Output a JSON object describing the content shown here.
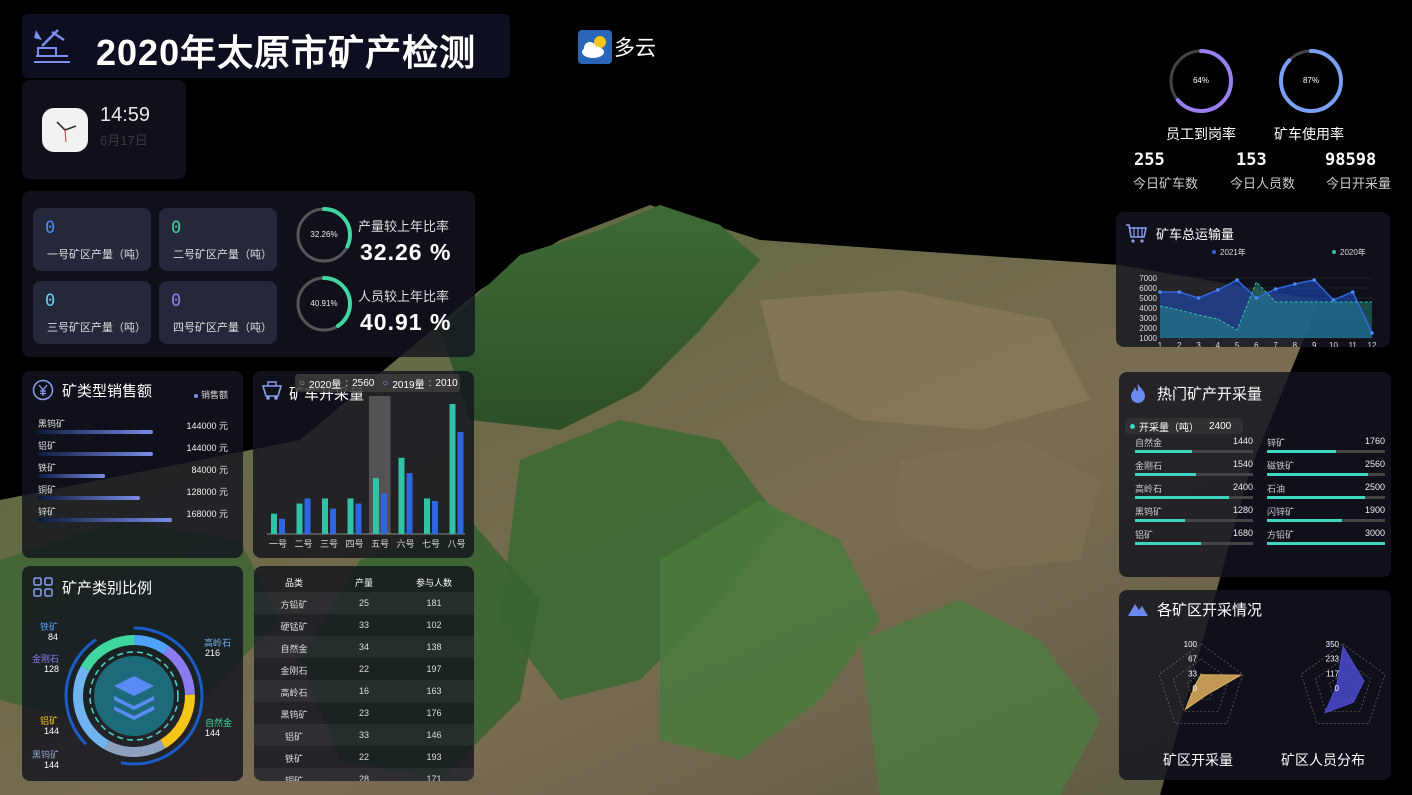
{
  "header": {
    "title": "2020年太原市矿产检测"
  },
  "weather": {
    "text": "多云",
    "icon": "cloud-sun-icon"
  },
  "clock": {
    "time": "14:59",
    "date": "6月17日"
  },
  "mines": [
    {
      "value": "0",
      "label": "一号矿区产量（吨）",
      "color": "#4d8cf5"
    },
    {
      "value": "0",
      "label": "二号矿区产量（吨）",
      "color": "#3fd6a0"
    },
    {
      "value": "0",
      "label": "三号矿区产量（吨）",
      "color": "#6ad0e8"
    },
    {
      "value": "0",
      "label": "四号矿区产量（吨）",
      "color": "#9a7ef0"
    }
  ],
  "ratios": [
    {
      "label": "产量较上年比率",
      "value": "32.26 %",
      "ring": "32.26%",
      "pct": 32.26
    },
    {
      "label": "人员较上年比率",
      "value": "40.91 %",
      "ring": "40.91%",
      "pct": 40.91
    }
  ],
  "top_rings": [
    {
      "label": "员工到岗率",
      "text": "64%",
      "pct": 64
    },
    {
      "label": "矿车使用率",
      "text": "87%",
      "pct": 87
    }
  ],
  "top_stats": [
    {
      "value": "255",
      "label": "今日矿车数"
    },
    {
      "value": "153",
      "label": "今日人员数"
    },
    {
      "value": "98598",
      "label": "今日开采量"
    }
  ],
  "sales": {
    "title": "矿类型销售额",
    "legend": "销售额",
    "rows": [
      {
        "name": "黑钨矿",
        "value": "144000 元",
        "amount": 144000
      },
      {
        "name": "铝矿",
        "value": "144000 元",
        "amount": 144000
      },
      {
        "name": "铁矿",
        "value": "84000 元",
        "amount": 84000
      },
      {
        "name": "铜矿",
        "value": "128000 元",
        "amount": 128000
      },
      {
        "name": "锌矿",
        "value": "168000 元",
        "amount": 168000
      }
    ]
  },
  "mining": {
    "title": "矿车开采量",
    "legend": [
      {
        "name": "2020量",
        "value": "2560"
      },
      {
        "name": "2019量",
        "value": "2010"
      }
    ]
  },
  "category": {
    "title": "矿产类别比例",
    "items": [
      {
        "name": "铁矿",
        "value": "84",
        "color": "#4ea3ff"
      },
      {
        "name": "金刚石",
        "value": "128",
        "color": "#8a7cf0"
      },
      {
        "name": "铝矿",
        "value": "144",
        "color": "#f5c518"
      },
      {
        "name": "黑钨矿",
        "value": "144",
        "color": "#8ea0c0"
      },
      {
        "name": "高岭石",
        "value": "216",
        "color": "#6fb3f0"
      },
      {
        "name": "自然金",
        "value": "144",
        "color": "#3fd6a0"
      }
    ]
  },
  "table": {
    "headers": [
      "品类",
      "产量",
      "参与人数"
    ],
    "rows": [
      [
        "方铅矿",
        "25",
        "181"
      ],
      [
        "硬锰矿",
        "33",
        "102"
      ],
      [
        "自然金",
        "34",
        "138"
      ],
      [
        "金刚石",
        "22",
        "197"
      ],
      [
        "高岭石",
        "16",
        "163"
      ],
      [
        "黑钨矿",
        "23",
        "176"
      ],
      [
        "铝矿",
        "33",
        "146"
      ],
      [
        "铁矿",
        "22",
        "193"
      ],
      [
        "铜矿",
        "28",
        "171"
      ]
    ]
  },
  "transport": {
    "title": "矿车总运输量",
    "legend": [
      "2021年",
      "2020年"
    ]
  },
  "hot": {
    "title": "热门矿产开采量",
    "tooltip_label": "开采量（吨）",
    "tooltip_value": "2400",
    "left": [
      {
        "name": "自然金",
        "value": "1440",
        "amount": 1440
      },
      {
        "name": "金刚石",
        "value": "1540",
        "amount": 1540
      },
      {
        "name": "高岭石",
        "value": "2400",
        "amount": 2400
      },
      {
        "name": "黑钨矿",
        "value": "1280",
        "amount": 1280
      },
      {
        "name": "铝矿",
        "value": "1680",
        "amount": 1680
      }
    ],
    "right": [
      {
        "name": "锌矿",
        "value": "1760",
        "amount": 1760
      },
      {
        "name": "磁铁矿",
        "value": "2560",
        "amount": 2560
      },
      {
        "name": "石油",
        "value": "2500",
        "amount": 2500
      },
      {
        "name": "闪锌矿",
        "value": "1900",
        "amount": 1900
      },
      {
        "name": "方铅矿",
        "value": "3000",
        "amount": 3000
      }
    ]
  },
  "radar": {
    "title": "各矿区开采情况",
    "charts": [
      {
        "label": "矿区开采量",
        "ticks": [
          "100",
          "67",
          "33",
          "0"
        ],
        "color": "#e0b060"
      },
      {
        "label": "矿区人员分布",
        "ticks": [
          "350",
          "233",
          "117",
          "0"
        ],
        "color": "#4a4ad0"
      }
    ]
  },
  "chart_data": [
    {
      "type": "bar",
      "title": "矿车开采量",
      "categories": [
        "一号",
        "二号",
        "三号",
        "四号",
        "五号",
        "六号",
        "七号",
        "八号"
      ],
      "series": [
        {
          "name": "2020量",
          "values": [
            400,
            600,
            700,
            700,
            1100,
            1500,
            700,
            2560
          ]
        },
        {
          "name": "2019量",
          "values": [
            300,
            700,
            500,
            600,
            800,
            1200,
            650,
            2010
          ]
        }
      ],
      "ylim": [
        0,
        2560
      ]
    },
    {
      "type": "line",
      "title": "矿车总运输量",
      "x": [
        1,
        2,
        3,
        4,
        5,
        6,
        7,
        8,
        9,
        10,
        11,
        12
      ],
      "yticks": [
        1000,
        2000,
        3000,
        4000,
        5000,
        6000,
        7000
      ],
      "ylim": [
        1000,
        7000
      ],
      "series": [
        {
          "name": "2021年",
          "values": [
            5600,
            5600,
            5000,
            5800,
            6800,
            5000,
            5900,
            6400,
            6800,
            4800,
            5600,
            1500
          ]
        },
        {
          "name": "2020年",
          "values": [
            4200,
            3800,
            3300,
            2900,
            1800,
            6600,
            4600,
            4600,
            4600,
            4600,
            4600,
            4600
          ]
        }
      ]
    },
    {
      "type": "pie",
      "title": "矿产类别比例",
      "categories": [
        "铁矿",
        "金刚石",
        "铝矿",
        "黑钨矿",
        "高岭石",
        "自然金"
      ],
      "values": [
        84,
        128,
        144,
        144,
        216,
        144
      ]
    }
  ]
}
